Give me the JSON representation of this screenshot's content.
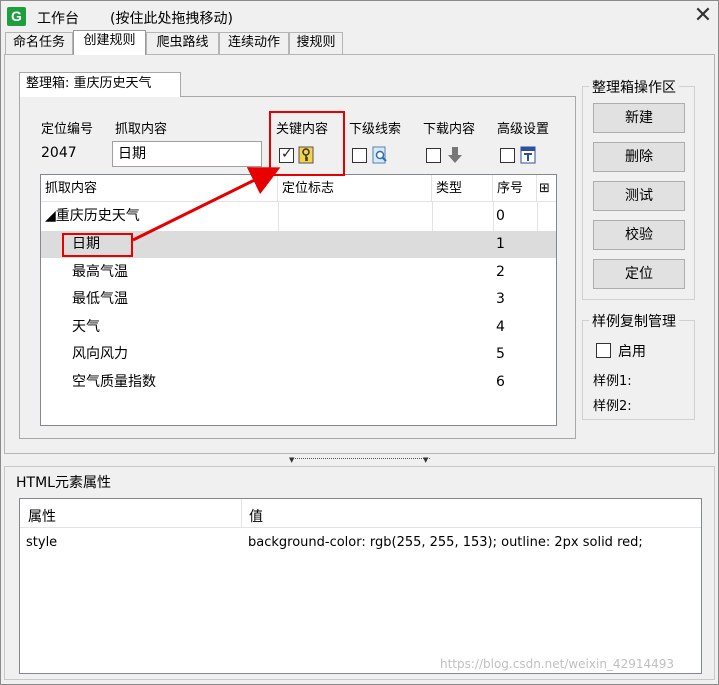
{
  "window": {
    "app_icon_letter": "G",
    "title": "工作台",
    "drag_hint": "(按住此处拖拽移动)",
    "close_glyph": "✕"
  },
  "tabs": [
    {
      "label": "命名任务",
      "active": false
    },
    {
      "label": "创建规则",
      "active": true
    },
    {
      "label": "爬虫路线",
      "active": false
    },
    {
      "label": "连续动作",
      "active": false
    },
    {
      "label": "搜规则",
      "active": false
    }
  ],
  "organizer": {
    "tab_label": "整理箱: 重庆历史天气",
    "position_id_label": "定位编号",
    "position_id_value": "2047",
    "capture_label": "抓取内容",
    "capture_value": "日期",
    "options": [
      {
        "label": "关键内容",
        "checked": true,
        "icon": "key-icon"
      },
      {
        "label": "下级线索",
        "checked": false,
        "icon": "search-page-icon"
      },
      {
        "label": "下载内容",
        "checked": false,
        "icon": "download-arrow-icon"
      },
      {
        "label": "高级设置",
        "checked": false,
        "icon": "text-format-icon"
      }
    ]
  },
  "grid": {
    "columns": [
      "抓取内容",
      "定位标志",
      "类型",
      "序号"
    ],
    "column_picker_glyph": "⊞",
    "rows": [
      {
        "name": "◢重庆历史天气",
        "marker": "",
        "type": "",
        "index": "0"
      },
      {
        "name": "日期",
        "marker": "",
        "type": "",
        "index": "1"
      },
      {
        "name": "最高气温",
        "marker": "",
        "type": "",
        "index": "2"
      },
      {
        "name": "最低气温",
        "marker": "",
        "type": "",
        "index": "3"
      },
      {
        "name": "天气",
        "marker": "",
        "type": "",
        "index": "4"
      },
      {
        "name": "风向风力",
        "marker": "",
        "type": "",
        "index": "5"
      },
      {
        "name": "空气质量指数",
        "marker": "",
        "type": "",
        "index": "6"
      }
    ]
  },
  "ops": {
    "title": "整理箱操作区",
    "buttons": [
      "新建",
      "删除",
      "测试",
      "校验",
      "定位"
    ]
  },
  "sample": {
    "title": "样例复制管理",
    "enable_label": "启用",
    "enabled": false,
    "sample1_label": "样例1:",
    "sample2_label": "样例2:"
  },
  "html_props": {
    "title": "HTML元素属性",
    "columns": [
      "属性",
      "值"
    ],
    "rows": [
      {
        "attr": "style",
        "value": "background-color: rgb(255, 255, 153); outline: 2px solid red;"
      }
    ]
  },
  "watermark": "https://blog.csdn.net/weixin_42914493",
  "colors": {
    "highlight_red": "#e60000",
    "app_green": "#1e9e3e"
  }
}
